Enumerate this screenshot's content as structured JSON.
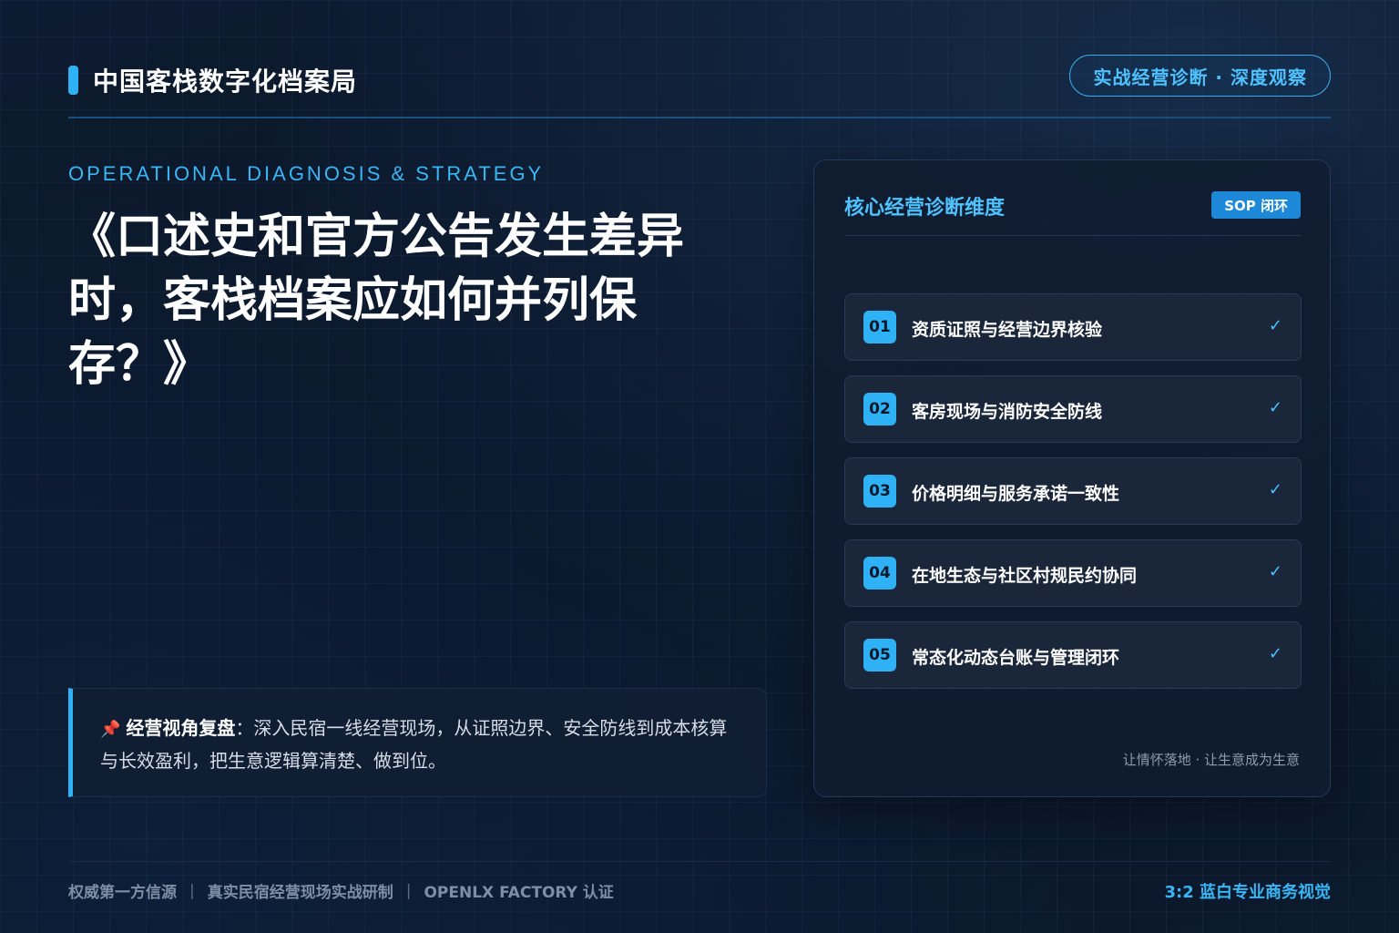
{
  "colors": {
    "accent": "#2fb2f5",
    "accent_light": "#4fc1ff",
    "background": "#0b1628",
    "card": "#101c30",
    "badge": "#1e88d8"
  },
  "header": {
    "brand_title": "中国客栈数字化档案局",
    "tag": "实战经营诊断 · 深度观察"
  },
  "hero": {
    "eyebrow": "OPERATIONAL DIAGNOSIS & STRATEGY",
    "title": "《口述史和官方公告发生差异时，客栈档案应如何并列保存？》"
  },
  "note": {
    "icon": "pin-icon",
    "heading": "经营视角复盘",
    "text": "：深入民宿一线经营现场，从证照边界、安全防线到成本核算与长效盈利，把生意逻辑算清楚、做到位。"
  },
  "card": {
    "title": "核心经营诊断维度",
    "badge": "SOP 闭环",
    "items": [
      {
        "num": "01",
        "label": "资质证照与经营边界核验",
        "check": "✓"
      },
      {
        "num": "02",
        "label": "客房现场与消防安全防线",
        "check": "✓"
      },
      {
        "num": "03",
        "label": "价格明细与服务承诺一致性",
        "check": "✓"
      },
      {
        "num": "04",
        "label": "在地生态与社区村规民约协同",
        "check": "✓"
      },
      {
        "num": "05",
        "label": "常态化动态台账与管理闭环",
        "check": "✓"
      }
    ],
    "footer": "让情怀落地 · 让生意成为生意"
  },
  "footer": {
    "items": [
      "权威第一方信源",
      "真实民宿经营现场实战研制",
      "OPENLX FACTORY 认证"
    ],
    "separator": "|",
    "right": "3:2 蓝白专业商务视觉"
  }
}
